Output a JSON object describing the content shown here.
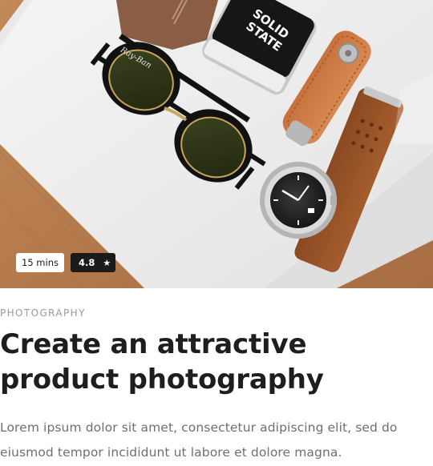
{
  "card": {
    "duration": "15 mins",
    "rating": "4.8",
    "rating_icon": "star-icon",
    "category": "PHOTOGRAPHY",
    "title": "Create an attractive product photography",
    "description": "Lorem ipsum dolor sit amet, consectetur adipiscing elit, sed do eiusmod tempor incididunt ut labore et dolore magna.",
    "image_text": {
      "tin_line1": "SOLID",
      "tin_line2": "STATE",
      "glasses_brand": "Ray-Ban"
    }
  },
  "colors": {
    "text_dark": "#1e1e1e",
    "text_muted": "#6f6f6f",
    "category": "#9a9a9a",
    "rating_badge": "#1b1b1b",
    "time_badge": "#ffffff"
  }
}
